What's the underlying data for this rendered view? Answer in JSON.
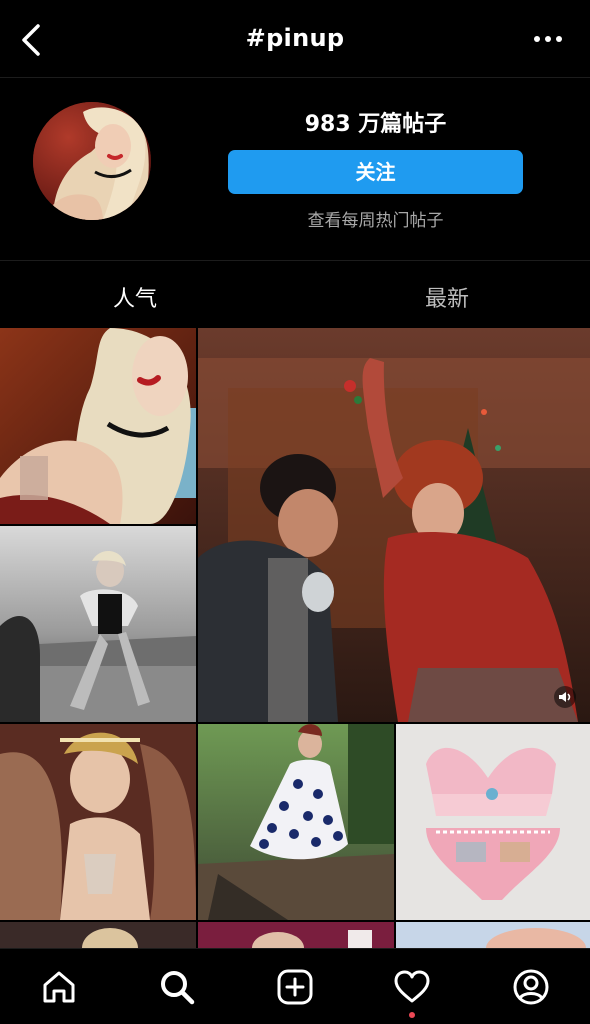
{
  "header": {
    "title": "#pinup",
    "back_icon": "chevron-left-icon",
    "more_icon": "more-horizontal-icon"
  },
  "profile": {
    "post_count": "983 万篇帖子",
    "follow_label": "关注",
    "weekly_link": "查看每周热门帖子"
  },
  "tabs": [
    {
      "label": "人气",
      "active": true
    },
    {
      "label": "最新",
      "active": false
    }
  ],
  "grid": {
    "video_icon": "speaker-icon"
  },
  "bottom_nav": {
    "items": [
      "home-icon",
      "search-icon",
      "create-icon",
      "activity-icon",
      "profile-icon"
    ],
    "active": "search-icon",
    "notification_color": "#ed4956"
  },
  "colors": {
    "background": "#000000",
    "accent": "#1f9bf0",
    "secondary_text": "#a8a8a8"
  }
}
